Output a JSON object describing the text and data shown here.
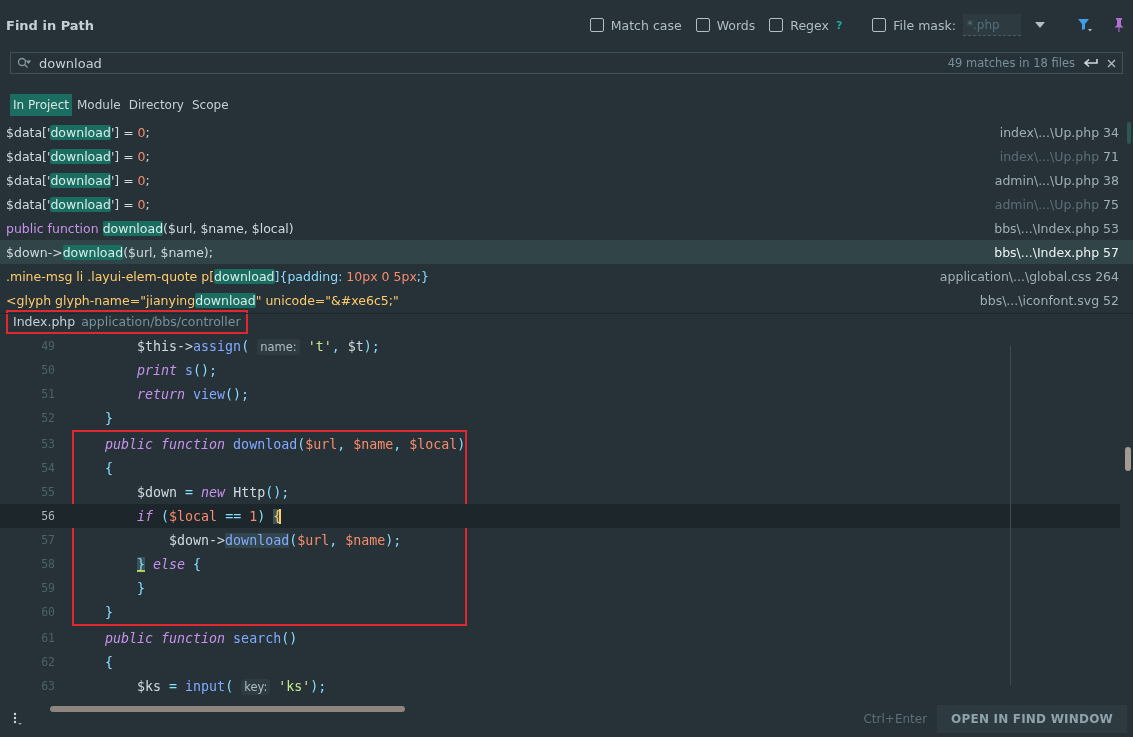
{
  "title": "Find in Path",
  "options": [
    {
      "label": "Match case",
      "checked": false
    },
    {
      "label": "Words",
      "checked": false
    },
    {
      "label": "Regex",
      "checked": false,
      "help": "?"
    }
  ],
  "file_mask": {
    "label": "File mask:",
    "checked": false,
    "placeholder": "*.php"
  },
  "search": {
    "value": "download",
    "summary": "49 matches in 18 files"
  },
  "scopes": [
    {
      "label": "In Project",
      "selected": true
    },
    {
      "label": "Module",
      "selected": false
    },
    {
      "label": "Directory",
      "selected": false
    },
    {
      "label": "Scope",
      "selected": false
    }
  ],
  "results": [
    {
      "selected": false,
      "muted": false,
      "location": "index\\...\\Up.php",
      "line": "34",
      "parts": [
        {
          "text": "$data['",
          "kind": "plain"
        },
        {
          "text": "download",
          "kind": "match"
        },
        {
          "text": "'] = ",
          "kind": "plain"
        },
        {
          "text": "0",
          "kind": "number"
        },
        {
          "text": ";",
          "kind": "plain"
        }
      ]
    },
    {
      "selected": false,
      "muted": true,
      "location": "index\\...\\Up.php",
      "line": "71",
      "parts": [
        {
          "text": "$data['",
          "kind": "plain"
        },
        {
          "text": "download",
          "kind": "match"
        },
        {
          "text": "'] = ",
          "kind": "plain"
        },
        {
          "text": "0",
          "kind": "number"
        },
        {
          "text": ";",
          "kind": "plain"
        }
      ]
    },
    {
      "selected": false,
      "muted": false,
      "location": "admin\\...\\Up.php",
      "line": "38",
      "parts": [
        {
          "text": "$data['",
          "kind": "plain"
        },
        {
          "text": "download",
          "kind": "match"
        },
        {
          "text": "'] = ",
          "kind": "plain"
        },
        {
          "text": "0",
          "kind": "number"
        },
        {
          "text": ";",
          "kind": "plain"
        }
      ]
    },
    {
      "selected": false,
      "muted": true,
      "location": "admin\\...\\Up.php",
      "line": "75",
      "parts": [
        {
          "text": "$data['",
          "kind": "plain"
        },
        {
          "text": "download",
          "kind": "match"
        },
        {
          "text": "'] = ",
          "kind": "plain"
        },
        {
          "text": "0",
          "kind": "number"
        },
        {
          "text": ";",
          "kind": "plain"
        }
      ]
    },
    {
      "selected": false,
      "muted": false,
      "location": "bbs\\...\\Index.php",
      "line": "53",
      "parts": [
        {
          "text": "public function ",
          "kind": "keyword"
        },
        {
          "text": "download",
          "kind": "match"
        },
        {
          "text": "($url, $name, $local)",
          "kind": "plain"
        }
      ]
    },
    {
      "selected": true,
      "muted": false,
      "location": "bbs\\...\\Index.php",
      "line": "57",
      "parts": [
        {
          "text": "$down->",
          "kind": "plain"
        },
        {
          "text": "download",
          "kind": "match"
        },
        {
          "text": "($url, $name);",
          "kind": "plain"
        }
      ]
    },
    {
      "selected": false,
      "muted": false,
      "location": "application\\...\\global.css",
      "line": "264",
      "parts": [
        {
          "text": ".mine-msg li .layui-elem-quote p[",
          "kind": "selector"
        },
        {
          "text": "download",
          "kind": "match"
        },
        {
          "text": "]{padding: ",
          "kind": "punct"
        },
        {
          "text": "10px 0 5px",
          "kind": "number"
        },
        {
          "text": ";}",
          "kind": "punct"
        }
      ]
    },
    {
      "selected": false,
      "muted": false,
      "location": "bbs\\...\\iconfont.svg",
      "line": "52",
      "parts": [
        {
          "text": "<glyph glyph-name=\"jianying",
          "kind": "selector"
        },
        {
          "text": "download",
          "kind": "match"
        },
        {
          "text": "\" unicode=\"&#xe6c5;\"",
          "kind": "selector"
        }
      ]
    }
  ],
  "preview": {
    "file": "Index.php",
    "path": "application/bbs/controller",
    "framed": true
  },
  "code": [
    {
      "kind": "line",
      "n": "49",
      "current": false,
      "parts": [
        {
          "text": "        $this->",
          "kind": "plain"
        },
        {
          "text": "assign",
          "kind": "func"
        },
        {
          "text": "( ",
          "kind": "punct"
        },
        {
          "text": "name:",
          "kind": "hint"
        },
        {
          "text": " 't'",
          "kind": "string"
        },
        {
          "text": ", ",
          "kind": "punct"
        },
        {
          "text": "$t",
          "kind": "plain"
        },
        {
          "text": ");",
          "kind": "punct"
        }
      ]
    },
    {
      "kind": "line",
      "n": "50",
      "current": false,
      "parts": [
        {
          "text": "        print",
          "kind": "keyword"
        },
        {
          "text": " s",
          "kind": "func"
        },
        {
          "text": "();",
          "kind": "punct"
        }
      ]
    },
    {
      "kind": "line",
      "n": "51",
      "current": false,
      "parts": [
        {
          "text": "        return",
          "kind": "keyword"
        },
        {
          "text": " view",
          "kind": "func"
        },
        {
          "text": "();",
          "kind": "punct"
        }
      ]
    },
    {
      "kind": "line",
      "n": "52",
      "current": false,
      "parts": [
        {
          "text": "    }",
          "kind": "punct"
        }
      ]
    },
    {
      "kind": "frame",
      "lines": [
        {
          "kind": "line",
          "n": "53",
          "current": false,
          "parts": [
            {
              "text": "    public function",
              "kind": "keyword"
            },
            {
              "text": " download",
              "kind": "func"
            },
            {
              "text": "(",
              "kind": "punct"
            },
            {
              "text": "$url",
              "kind": "var"
            },
            {
              "text": ", ",
              "kind": "punct"
            },
            {
              "text": "$name",
              "kind": "var"
            },
            {
              "text": ", ",
              "kind": "punct"
            },
            {
              "text": "$local",
              "kind": "var"
            },
            {
              "text": ")",
              "kind": "punct"
            }
          ]
        },
        {
          "kind": "line",
          "n": "54",
          "current": false,
          "parts": [
            {
              "text": "    {",
              "kind": "punct"
            }
          ]
        },
        {
          "kind": "line",
          "n": "55",
          "current": false,
          "parts": [
            {
              "text": "        $down",
              "kind": "plain"
            },
            {
              "text": " = ",
              "kind": "punct"
            },
            {
              "text": "new",
              "kind": "keyword"
            },
            {
              "text": " Http",
              "kind": "plain"
            },
            {
              "text": "();",
              "kind": "punct"
            }
          ]
        },
        {
          "kind": "line",
          "n": "56",
          "current": true,
          "parts": [
            {
              "text": "        if",
              "kind": "keyword"
            },
            {
              "text": " (",
              "kind": "punct"
            },
            {
              "text": "$local",
              "kind": "var"
            },
            {
              "text": " == ",
              "kind": "punct"
            },
            {
              "text": "1",
              "kind": "number"
            },
            {
              "text": ") ",
              "kind": "punct"
            },
            {
              "text": "{",
              "kind": "brace"
            }
          ]
        },
        {
          "kind": "line",
          "n": "57",
          "current": false,
          "parts": [
            {
              "text": "            $down->",
              "kind": "plain"
            },
            {
              "text": "download",
              "kind": "usage"
            },
            {
              "text": "(",
              "kind": "punct"
            },
            {
              "text": "$url",
              "kind": "var"
            },
            {
              "text": ", ",
              "kind": "punct"
            },
            {
              "text": "$name",
              "kind": "var"
            },
            {
              "text": ");",
              "kind": "punct"
            }
          ]
        },
        {
          "kind": "line",
          "n": "58",
          "current": false,
          "parts": [
            {
              "text": "        }",
              "kind": "brace2"
            },
            {
              "text": " else",
              "kind": "keyword"
            },
            {
              "text": " {",
              "kind": "punct"
            }
          ]
        },
        {
          "kind": "line",
          "n": "59",
          "current": false,
          "parts": [
            {
              "text": "        }",
              "kind": "punct"
            }
          ]
        },
        {
          "kind": "line",
          "n": "60",
          "current": false,
          "parts": [
            {
              "text": "    }",
              "kind": "punct"
            }
          ]
        }
      ]
    },
    {
      "kind": "line",
      "n": "61",
      "current": false,
      "parts": [
        {
          "text": "    public function",
          "kind": "keyword"
        },
        {
          "text": " search",
          "kind": "func"
        },
        {
          "text": "()",
          "kind": "punct"
        }
      ]
    },
    {
      "kind": "line",
      "n": "62",
      "current": false,
      "parts": [
        {
          "text": "    {",
          "kind": "punct"
        }
      ]
    },
    {
      "kind": "line",
      "n": "63",
      "current": false,
      "parts": [
        {
          "text": "        $ks",
          "kind": "plain"
        },
        {
          "text": " = ",
          "kind": "punct"
        },
        {
          "text": "input",
          "kind": "func"
        },
        {
          "text": "( ",
          "kind": "punct"
        },
        {
          "text": "key:",
          "kind": "hint"
        },
        {
          "text": " 'ks'",
          "kind": "string"
        },
        {
          "text": ");",
          "kind": "punct"
        }
      ]
    }
  ],
  "footer": {
    "shortcut": "Ctrl+Enter",
    "button": "OPEN IN FIND WINDOW"
  }
}
